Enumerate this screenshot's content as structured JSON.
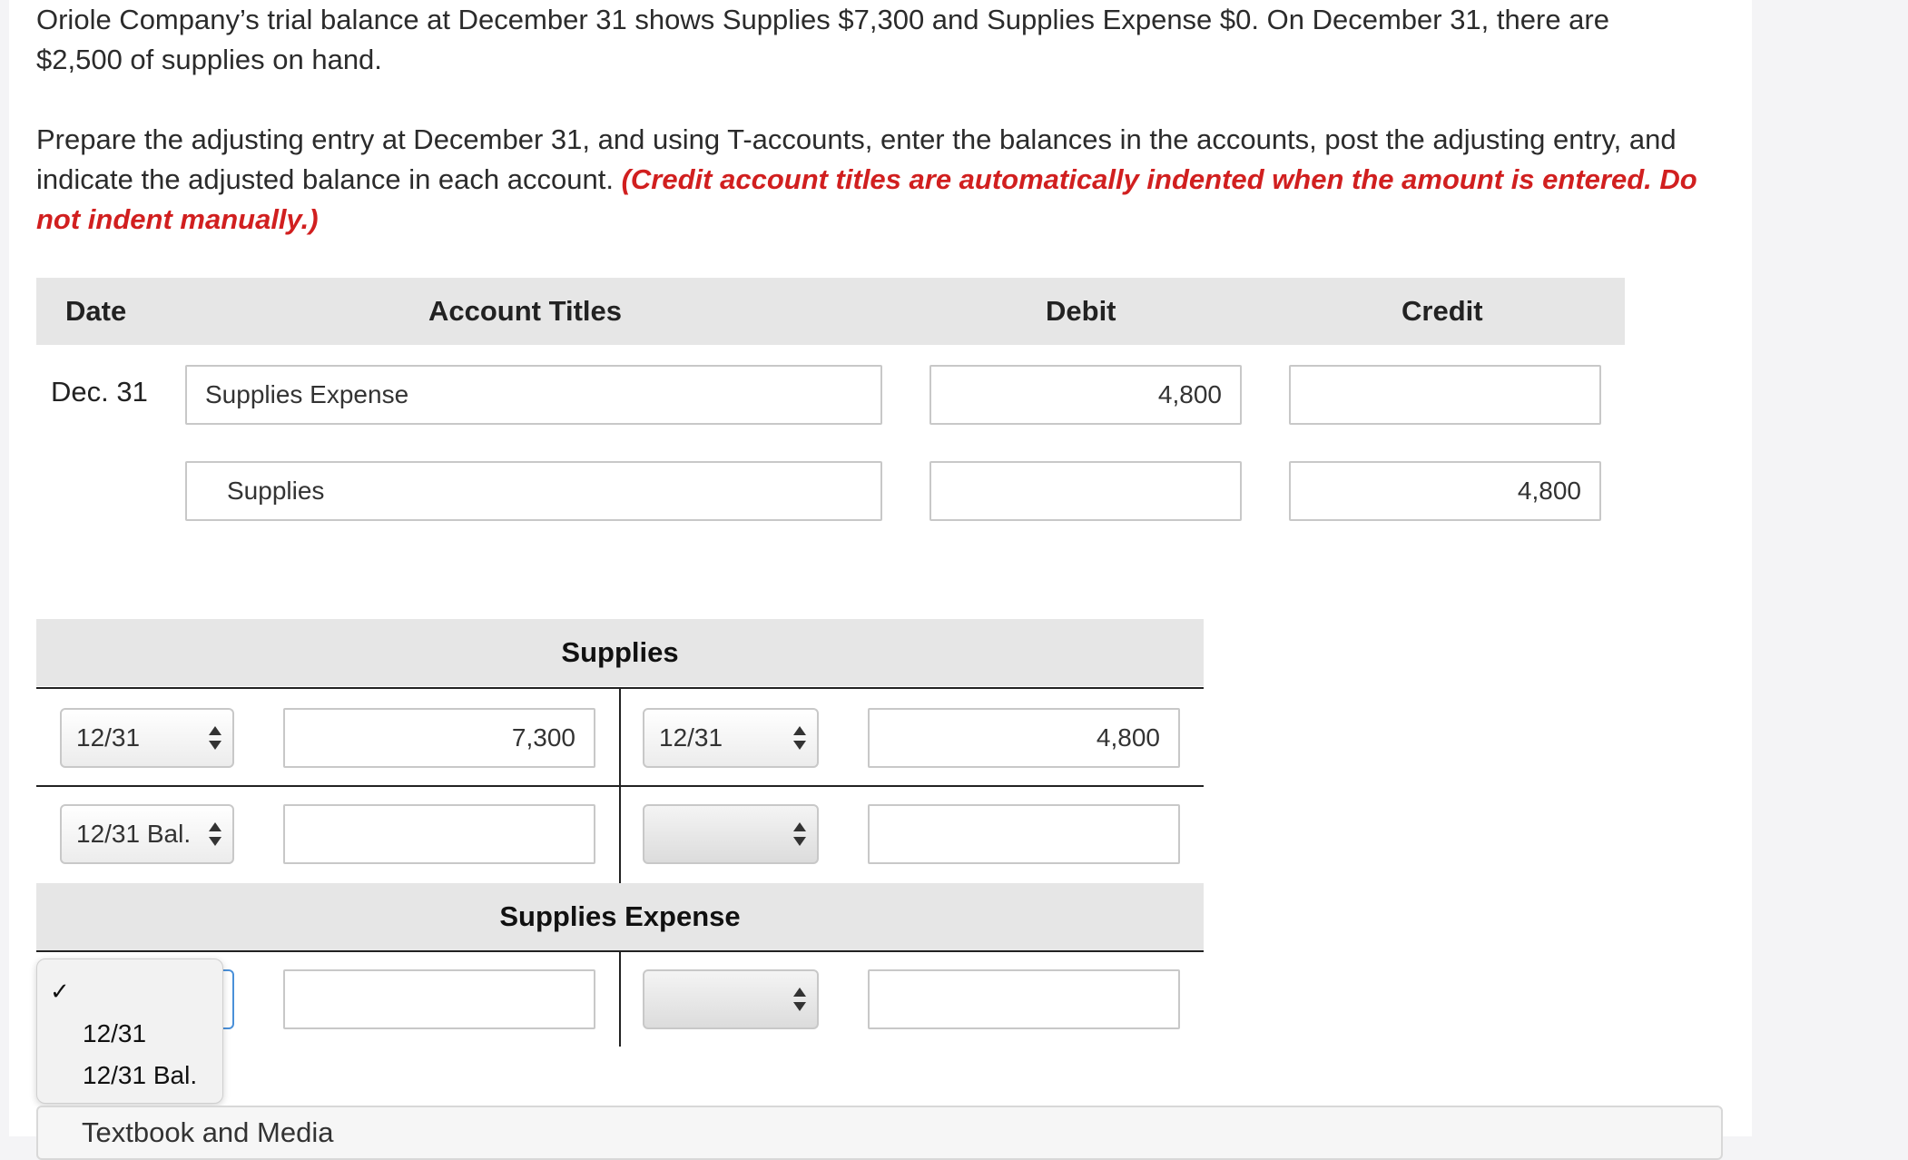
{
  "problem": {
    "line1": "Oriole Company’s trial balance at December 31 shows Supplies $7,300 and Supplies Expense $0. On December 31, there are",
    "line2": "$2,500 of supplies on hand.",
    "line3": "Prepare the adjusting entry at December 31, and using T-accounts, enter the balances in the accounts, post the adjusting entry, and",
    "line4a": "indicate the adjusted balance in each account.",
    "line4b": "(Credit account titles are automatically indented when the amount is entered. Do",
    "line5": "not indent manually.)"
  },
  "journal": {
    "headers": {
      "date": "Date",
      "titles": "Account Titles",
      "debit": "Debit",
      "credit": "Credit"
    },
    "rows": [
      {
        "date": "Dec. 31",
        "title": "Supplies Expense",
        "debit": "4,800",
        "credit": ""
      },
      {
        "date": "",
        "title": "Supplies",
        "debit": "",
        "credit": "4,800"
      }
    ]
  },
  "t_accounts": [
    {
      "name": "Supplies",
      "rows": [
        {
          "left_date": "12/31",
          "left_amount": "7,300",
          "right_date": "12/31",
          "right_amount": "4,800"
        },
        {
          "left_date": "12/31 Bal.",
          "left_amount": "",
          "right_date": "",
          "right_amount": ""
        }
      ]
    },
    {
      "name": "Supplies Expense",
      "rows": [
        {
          "left_date": "",
          "left_amount": "",
          "right_date": "",
          "right_amount": ""
        }
      ]
    }
  ],
  "dropdown_popup": {
    "checkmark": "✓",
    "options": [
      "12/31",
      "12/31 Bal."
    ]
  },
  "footer_partial": "Textbook and Media"
}
